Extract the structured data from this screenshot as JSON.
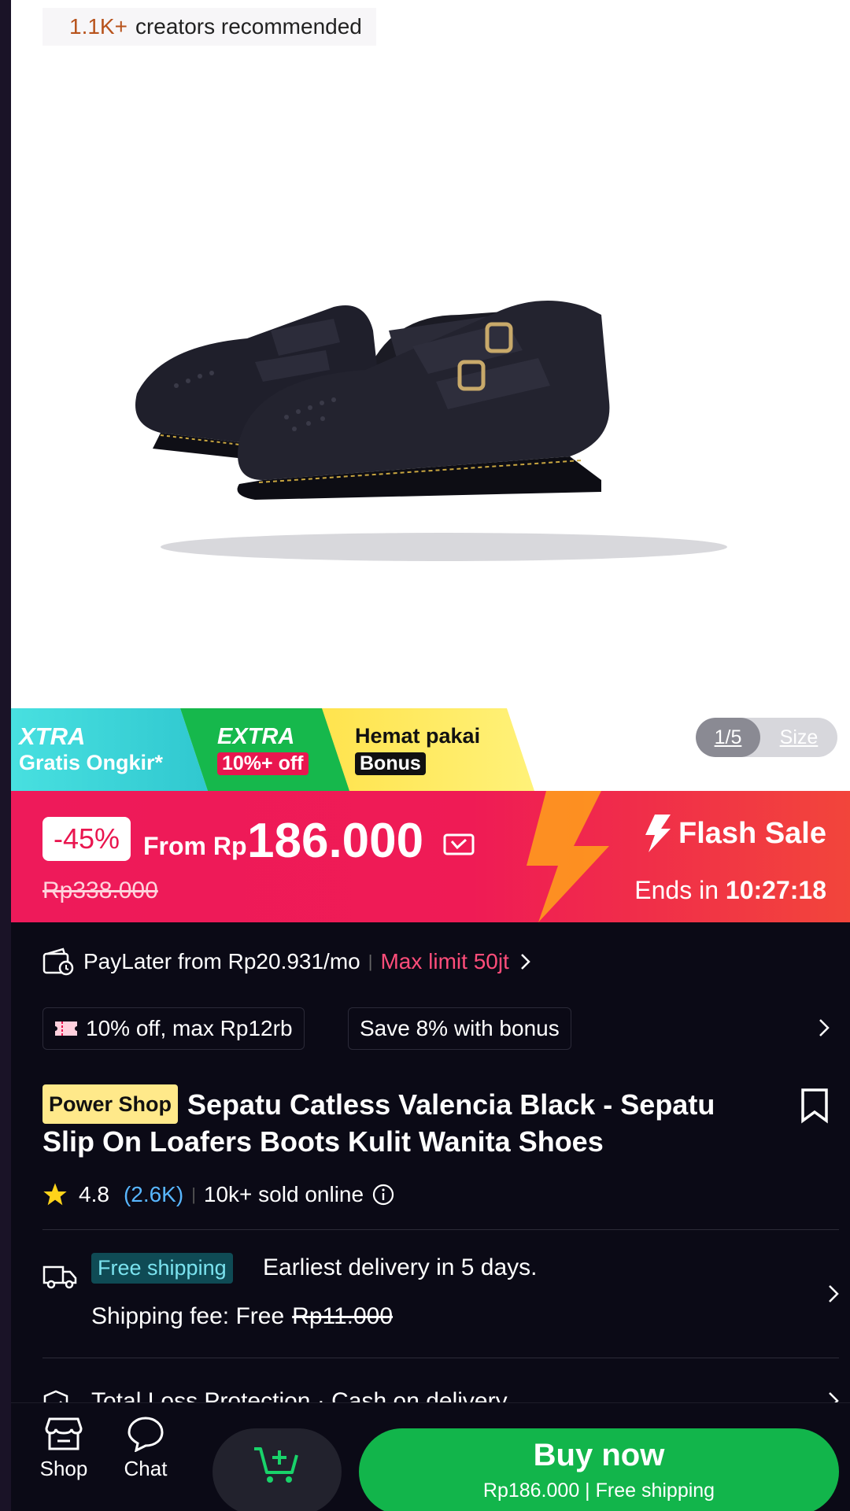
{
  "creators": {
    "count": "1.1K+",
    "text": "creators recommended"
  },
  "gallery": {
    "index": "1/5",
    "size_label": "Size"
  },
  "promos": {
    "xtra_title": "XTRA",
    "xtra_sub": "Gratis Ongkir*",
    "extra_title": "EXTRA",
    "extra_sub": "10%+ off",
    "hemat_title": "Hemat pakai",
    "hemat_sub": "Bonus"
  },
  "flash": {
    "discount": "-45%",
    "from_label": "From Rp",
    "price": "186.000",
    "old_price": "Rp338.000",
    "label": "Flash Sale",
    "ends_label": "Ends in",
    "countdown": "10:27:18"
  },
  "paylater": {
    "text": "PayLater from Rp20.931/mo",
    "limit": "Max limit 50jt"
  },
  "vouchers": {
    "chip1": "10% off, max Rp12rb",
    "chip2": "Save 8% with bonus"
  },
  "product": {
    "badge": "Power Shop",
    "title": "Sepatu Catless Valencia Black - Sepatu Slip On Loafers Boots Kulit Wanita Shoes",
    "rating": "4.8",
    "reviews": "(2.6K)",
    "sold": "10k+ sold online"
  },
  "shipping": {
    "badge": "Free shipping",
    "earliest": "Earliest delivery in 5 days.",
    "fee_label": "Shipping fee: Free",
    "fee_original": "Rp11.000"
  },
  "protection": {
    "text": "Total Loss Protection · Cash on delivery"
  },
  "bottom": {
    "shop": "Shop",
    "chat": "Chat",
    "buy": "Buy now",
    "buy_sub": "Rp186.000 | Free shipping"
  },
  "colors": {
    "brand_pink": "#ee1a5a",
    "buy_green": "#12b54b",
    "accent_blue": "#58b6ff"
  }
}
